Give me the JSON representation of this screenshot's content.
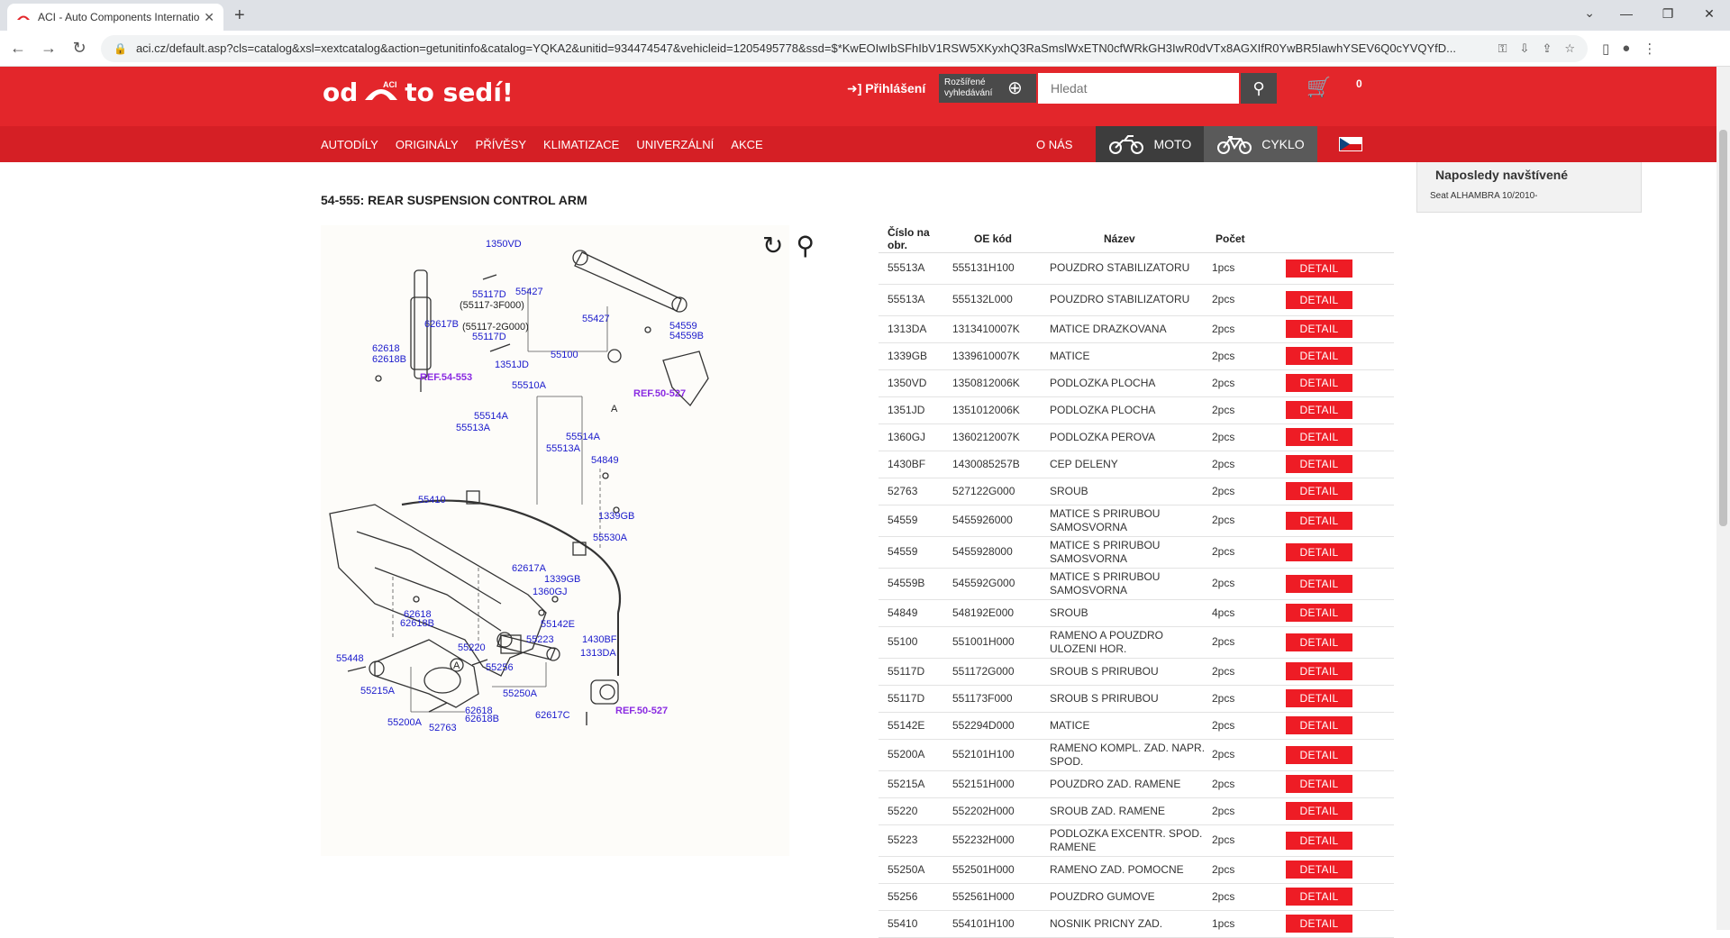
{
  "browser": {
    "tab_title": "ACI - Auto Components Internatio",
    "url": "aci.cz/default.asp?cls=catalog&xsl=xextcatalog&action=getunitinfo&catalog=YQKA2&unitid=934474547&vehicleid=1205495778&ssd=$*KwEOIwIbSFhIbV1RSW5XKyxhQ3RaSmslWxETN0cfWRkGH3IwR0dVTx8AGXIfR0YwBR5IawhYSEV6Q0cYVQYfD..."
  },
  "site": {
    "logo_left": "od",
    "logo_right": "to sedí!",
    "logo_badge": "ACI",
    "login": "Přihlášení",
    "advanced_search": "Rozšířené vyhledávání",
    "search_placeholder": "Hledat",
    "cart_count": "0",
    "nav": [
      "AUTODÍLY",
      "ORIGINÁLY",
      "PŘÍVĚSY",
      "KLIMATIZACE",
      "UNIVERZÁLNÍ",
      "AKCE"
    ],
    "about": "O NÁS",
    "moto": "MOTO",
    "cyklo": "CYKLO"
  },
  "recent": {
    "title": "Naposledy navštívené",
    "item": "Seat ALHAMBRA 10/2010-"
  },
  "page": {
    "title": "54-555: REAR SUSPENSION CONTROL ARM"
  },
  "diagram_labels": {
    "l1350VD": "1350VD",
    "l55117D_a": "55117D",
    "l3F000": "(55117-3F000)",
    "l55427_a": "55427",
    "l55427_b": "55427",
    "l2G000": "(55117-2G000)",
    "l55117D_b": "55117D",
    "l62617B": "62617B",
    "l62618": "62618",
    "l62618B": "62618B",
    "l1351JD": "1351JD",
    "l55100": "55100",
    "l54559": "54559",
    "l54559B": "54559B",
    "ref553": "REF.54-553",
    "ref527a": "REF.50-527",
    "l55510A": "55510A",
    "l55514A_a": "55514A",
    "l55513A_a": "55513A",
    "l55514A_b": "55514A",
    "l55513A_b": "55513A",
    "l54849": "54849",
    "l55410": "55410",
    "l1339GB_a": "1339GB",
    "l55530A": "55530A",
    "l62617A": "62617A",
    "l1339GB_b": "1339GB",
    "l1360GJ": "1360GJ",
    "l55142E": "55142E",
    "l62618_b": "62618",
    "l62618B_b": "62618B",
    "l55223": "55223",
    "l1430BF": "1430BF",
    "l1313DA": "1313DA",
    "l55220": "55220",
    "l55448": "55448",
    "l55256": "55256",
    "l55215A": "55215A",
    "l55250A": "55250A",
    "l55200A": "55200A",
    "l52763": "52763",
    "l62618_c": "62618",
    "l62618B_c": "62618B",
    "l62617C": "62617C",
    "ref527b": "REF.50-527",
    "circA1": "A",
    "circA2": "A"
  },
  "table": {
    "headers": [
      "Číslo na obr.",
      "OE kód",
      "Název",
      "Počet",
      ""
    ],
    "detail_label": "DETAIL",
    "rows": [
      {
        "num": "55513A",
        "oe": "555131H100",
        "name": "POUZDRO STABILIZATORU",
        "qty": "1pcs"
      },
      {
        "num": "55513A",
        "oe": "555132L000",
        "name": "POUZDRO STABILIZATORU",
        "qty": "2pcs"
      },
      {
        "num": "1313DA",
        "oe": "1313410007K",
        "name": "MATICE DRAZKOVANA",
        "qty": "2pcs"
      },
      {
        "num": "1339GB",
        "oe": "1339610007K",
        "name": "MATICE",
        "qty": "2pcs"
      },
      {
        "num": "1350VD",
        "oe": "1350812006K",
        "name": "PODLOZKA PLOCHA",
        "qty": "2pcs"
      },
      {
        "num": "1351JD",
        "oe": "1351012006K",
        "name": "PODLOZKA PLOCHA",
        "qty": "2pcs"
      },
      {
        "num": "1360GJ",
        "oe": "1360212007K",
        "name": "PODLOZKA PEROVA",
        "qty": "2pcs"
      },
      {
        "num": "1430BF",
        "oe": "1430085257B",
        "name": "CEP DELENY",
        "qty": "2pcs"
      },
      {
        "num": "52763",
        "oe": "527122G000",
        "name": "SROUB",
        "qty": "2pcs"
      },
      {
        "num": "54559",
        "oe": "5455926000",
        "name": "MATICE S PRIRUBOU SAMOSVORNA",
        "qty": "2pcs"
      },
      {
        "num": "54559",
        "oe": "5455928000",
        "name": "MATICE S PRIRUBOU SAMOSVORNA",
        "qty": "2pcs"
      },
      {
        "num": "54559B",
        "oe": "545592G000",
        "name": "MATICE S PRIRUBOU SAMOSVORNA",
        "qty": "2pcs"
      },
      {
        "num": "54849",
        "oe": "548192E000",
        "name": "SROUB",
        "qty": "4pcs"
      },
      {
        "num": "55100",
        "oe": "551001H000",
        "name": "RAMENO A POUZDRO ULOZENI HOR.",
        "qty": "2pcs"
      },
      {
        "num": "55117D",
        "oe": "551172G000",
        "name": "SROUB S PRIRUBOU",
        "qty": "2pcs"
      },
      {
        "num": "55117D",
        "oe": "551173F000",
        "name": "SROUB S PRIRUBOU",
        "qty": "2pcs"
      },
      {
        "num": "55142E",
        "oe": "552294D000",
        "name": "MATICE",
        "qty": "2pcs"
      },
      {
        "num": "55200A",
        "oe": "552101H100",
        "name": "RAMENO KOMPL. ZAD. NAPR. SPOD.",
        "qty": "2pcs"
      },
      {
        "num": "55215A",
        "oe": "552151H000",
        "name": "POUZDRO ZAD. RAMENE",
        "qty": "2pcs"
      },
      {
        "num": "55220",
        "oe": "552202H000",
        "name": "SROUB ZAD. RAMENE",
        "qty": "2pcs"
      },
      {
        "num": "55223",
        "oe": "552232H000",
        "name": "PODLOZKA EXCENTR. SPOD. RAMENE",
        "qty": "2pcs"
      },
      {
        "num": "55250A",
        "oe": "552501H000",
        "name": "RAMENO ZAD. POMOCNE",
        "qty": "2pcs"
      },
      {
        "num": "55256",
        "oe": "552561H000",
        "name": "POUZDRO GUMOVE",
        "qty": "2pcs"
      },
      {
        "num": "55410",
        "oe": "554101H100",
        "name": "NOSNIK PRICNY ZAD.",
        "qty": "1pcs"
      }
    ]
  }
}
